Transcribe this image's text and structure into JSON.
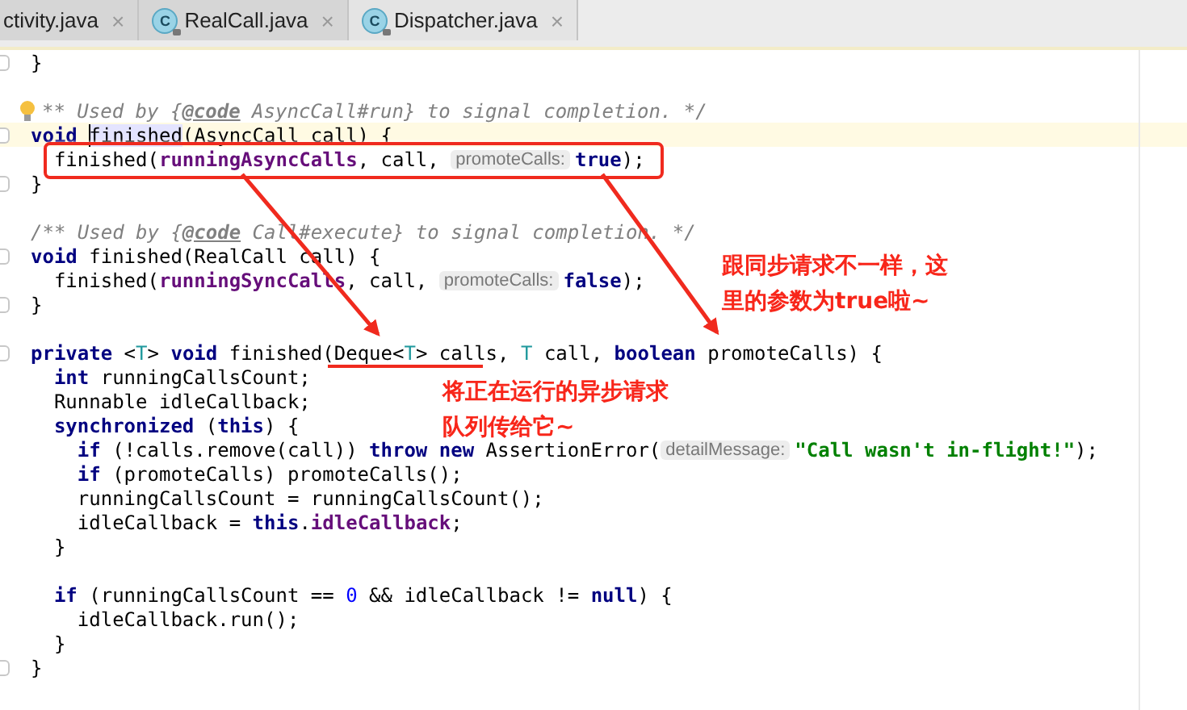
{
  "tabs": [
    {
      "label": "ctivity.java",
      "close": "×",
      "selected": false
    },
    {
      "label": "RealCall.java",
      "icon": "C",
      "close": "×",
      "selected": false
    },
    {
      "label": "Dispatcher.java",
      "icon": "C",
      "close": "×",
      "selected": true
    }
  ],
  "code_lines": [
    {
      "fold": true,
      "tokens": [
        {
          "kind": "plain",
          "text": "}"
        }
      ]
    },
    {
      "gap_before": true,
      "bulb": true,
      "tokens": [
        {
          "kind": "comment",
          "text": "** Used by {"
        },
        {
          "kind": "doc-tag",
          "text": "@code"
        },
        {
          "kind": "comment",
          "text": " AsyncCall#run} to signal completion. */"
        }
      ]
    },
    {
      "fold": true,
      "current": true,
      "tokens": [
        {
          "kind": "keyword",
          "text": "void "
        },
        {
          "kind": "usage",
          "text": "finished"
        },
        {
          "kind": "plain",
          "text": "(AsyncCall call) {"
        }
      ]
    },
    {
      "tokens": [
        {
          "kind": "plain",
          "text": "  finished("
        },
        {
          "kind": "field",
          "text": "runningAsyncCalls"
        },
        {
          "kind": "plain",
          "text": ", call, "
        },
        {
          "kind": "hint",
          "text": "promoteCalls:"
        },
        {
          "kind": "keyword",
          "text": "true"
        },
        {
          "kind": "plain",
          "text": ");"
        }
      ]
    },
    {
      "fold": true,
      "tokens": [
        {
          "kind": "plain",
          "text": "}"
        }
      ]
    },
    {
      "gap_before": true,
      "tokens": [
        {
          "kind": "comment",
          "text": "/** Used by {"
        },
        {
          "kind": "doc-tag",
          "text": "@code"
        },
        {
          "kind": "comment",
          "text": " Call#execute} to signal completion. */"
        }
      ]
    },
    {
      "fold": true,
      "tokens": [
        {
          "kind": "keyword",
          "text": "void "
        },
        {
          "kind": "plain",
          "text": "finished(RealCall call) {"
        }
      ]
    },
    {
      "tokens": [
        {
          "kind": "plain",
          "text": "  finished("
        },
        {
          "kind": "field",
          "text": "runningSyncCalls"
        },
        {
          "kind": "plain",
          "text": ", call, "
        },
        {
          "kind": "hint",
          "text": "promoteCalls:"
        },
        {
          "kind": "keyword",
          "text": "false"
        },
        {
          "kind": "plain",
          "text": ");"
        }
      ]
    },
    {
      "fold": true,
      "tokens": [
        {
          "kind": "plain",
          "text": "}"
        }
      ]
    },
    {
      "gap_before": true,
      "fold": true,
      "tokens": [
        {
          "kind": "keyword",
          "text": "private "
        },
        {
          "kind": "plain",
          "text": "<"
        },
        {
          "kind": "type-param",
          "text": "T"
        },
        {
          "kind": "plain",
          "text": "> "
        },
        {
          "kind": "keyword",
          "text": "void "
        },
        {
          "kind": "plain",
          "text": "finished(Deque<"
        },
        {
          "kind": "type-param",
          "text": "T"
        },
        {
          "kind": "plain",
          "text": "> calls, "
        },
        {
          "kind": "type-param",
          "text": "T"
        },
        {
          "kind": "plain",
          "text": " call, "
        },
        {
          "kind": "keyword",
          "text": "boolean "
        },
        {
          "kind": "plain",
          "text": "promoteCalls) {"
        }
      ]
    },
    {
      "tokens": [
        {
          "kind": "keyword",
          "text": "  int "
        },
        {
          "kind": "plain",
          "text": "runningCallsCount;"
        }
      ]
    },
    {
      "tokens": [
        {
          "kind": "plain",
          "text": "  Runnable idleCallback;"
        }
      ]
    },
    {
      "tokens": [
        {
          "kind": "keyword",
          "text": "  synchronized "
        },
        {
          "kind": "plain",
          "text": "("
        },
        {
          "kind": "keyword",
          "text": "this"
        },
        {
          "kind": "plain",
          "text": ") {"
        }
      ]
    },
    {
      "tokens": [
        {
          "kind": "keyword",
          "text": "    if "
        },
        {
          "kind": "plain",
          "text": "(!calls.remove(call)) "
        },
        {
          "kind": "keyword",
          "text": "throw new "
        },
        {
          "kind": "plain",
          "text": "AssertionError("
        },
        {
          "kind": "hint",
          "text": "detailMessage:"
        },
        {
          "kind": "string",
          "text": "\"Call wasn't in-flight!\""
        },
        {
          "kind": "plain",
          "text": ");"
        }
      ]
    },
    {
      "tokens": [
        {
          "kind": "keyword",
          "text": "    if "
        },
        {
          "kind": "plain",
          "text": "(promoteCalls) promoteCalls();"
        }
      ]
    },
    {
      "tokens": [
        {
          "kind": "plain",
          "text": "    runningCallsCount = runningCallsCount();"
        }
      ]
    },
    {
      "tokens": [
        {
          "kind": "plain",
          "text": "    idleCallback = "
        },
        {
          "kind": "keyword",
          "text": "this"
        },
        {
          "kind": "plain",
          "text": "."
        },
        {
          "kind": "field",
          "text": "idleCallback"
        },
        {
          "kind": "plain",
          "text": ";"
        }
      ]
    },
    {
      "tokens": [
        {
          "kind": "plain",
          "text": "  }"
        }
      ]
    },
    {
      "gap_before": true,
      "tokens": [
        {
          "kind": "keyword",
          "text": "  if "
        },
        {
          "kind": "plain",
          "text": "(runningCallsCount == "
        },
        {
          "kind": "number",
          "text": "0"
        },
        {
          "kind": "plain",
          "text": " && idleCallback != "
        },
        {
          "kind": "keyword",
          "text": "null"
        },
        {
          "kind": "plain",
          "text": ") {"
        }
      ]
    },
    {
      "tokens": [
        {
          "kind": "plain",
          "text": "    idleCallback.run();"
        }
      ]
    },
    {
      "tokens": [
        {
          "kind": "plain",
          "text": "  }"
        }
      ]
    },
    {
      "fold": true,
      "tokens": [
        {
          "kind": "plain",
          "text": "}"
        }
      ]
    }
  ],
  "notes": [
    {
      "lines": [
        "跟同步请求不一样，这",
        "里的参数为true啦~"
      ]
    },
    {
      "lines": [
        "将正在运行的异步请求",
        "队列传给它~"
      ]
    }
  ]
}
